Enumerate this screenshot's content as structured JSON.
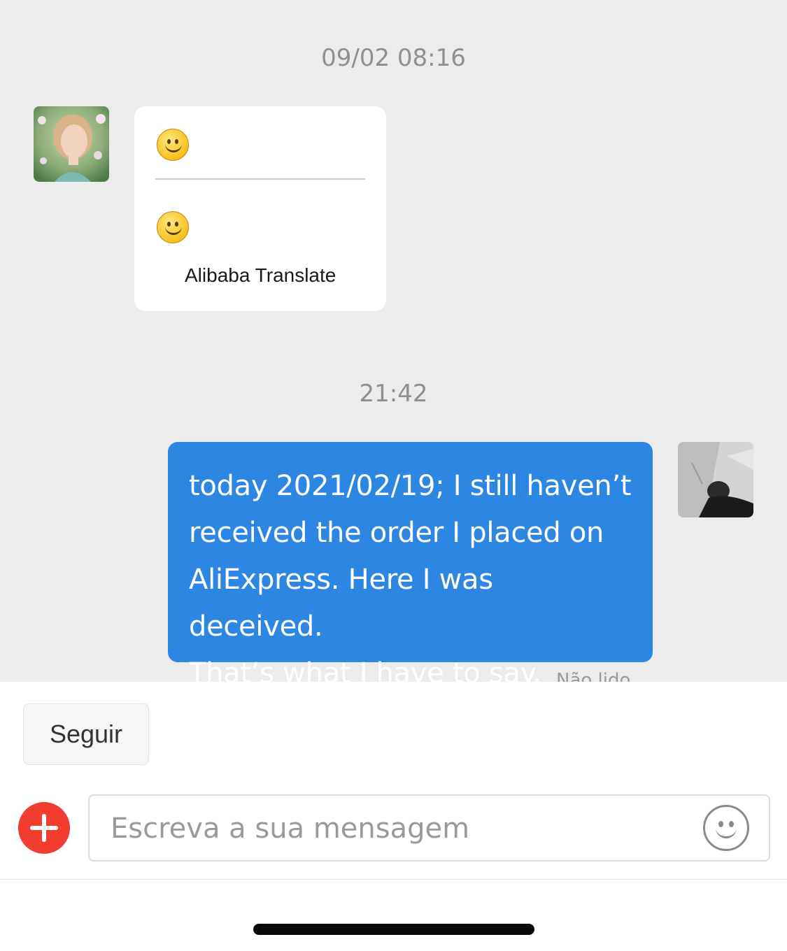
{
  "chat": {
    "timestamps": [
      "09/02 08:16",
      "21:42"
    ],
    "incoming": {
      "avatar_icon": "seller-avatar-photo",
      "original_icon": "smiley-emoji",
      "translated_icon": "smiley-emoji",
      "translate_label": "Alibaba Translate"
    },
    "outgoing": {
      "avatar_icon": "user-avatar-photo",
      "lines": [
        "today 2021/02/19; I still haven’t",
        "received the order I placed on",
        "AliExpress. Here I was deceived.",
        "That’s what I have to say."
      ],
      "status": "Não lido"
    }
  },
  "composer": {
    "follow_label": "Seguir",
    "add_icon": "plus-icon",
    "input_placeholder": "Escreva a sua mensagem",
    "input_value": "",
    "emoji_icon": "smiley-icon"
  },
  "colors": {
    "chat_background": "#ececec",
    "outgoing_bubble": "#2e86e3",
    "add_button": "#f23c2f"
  }
}
